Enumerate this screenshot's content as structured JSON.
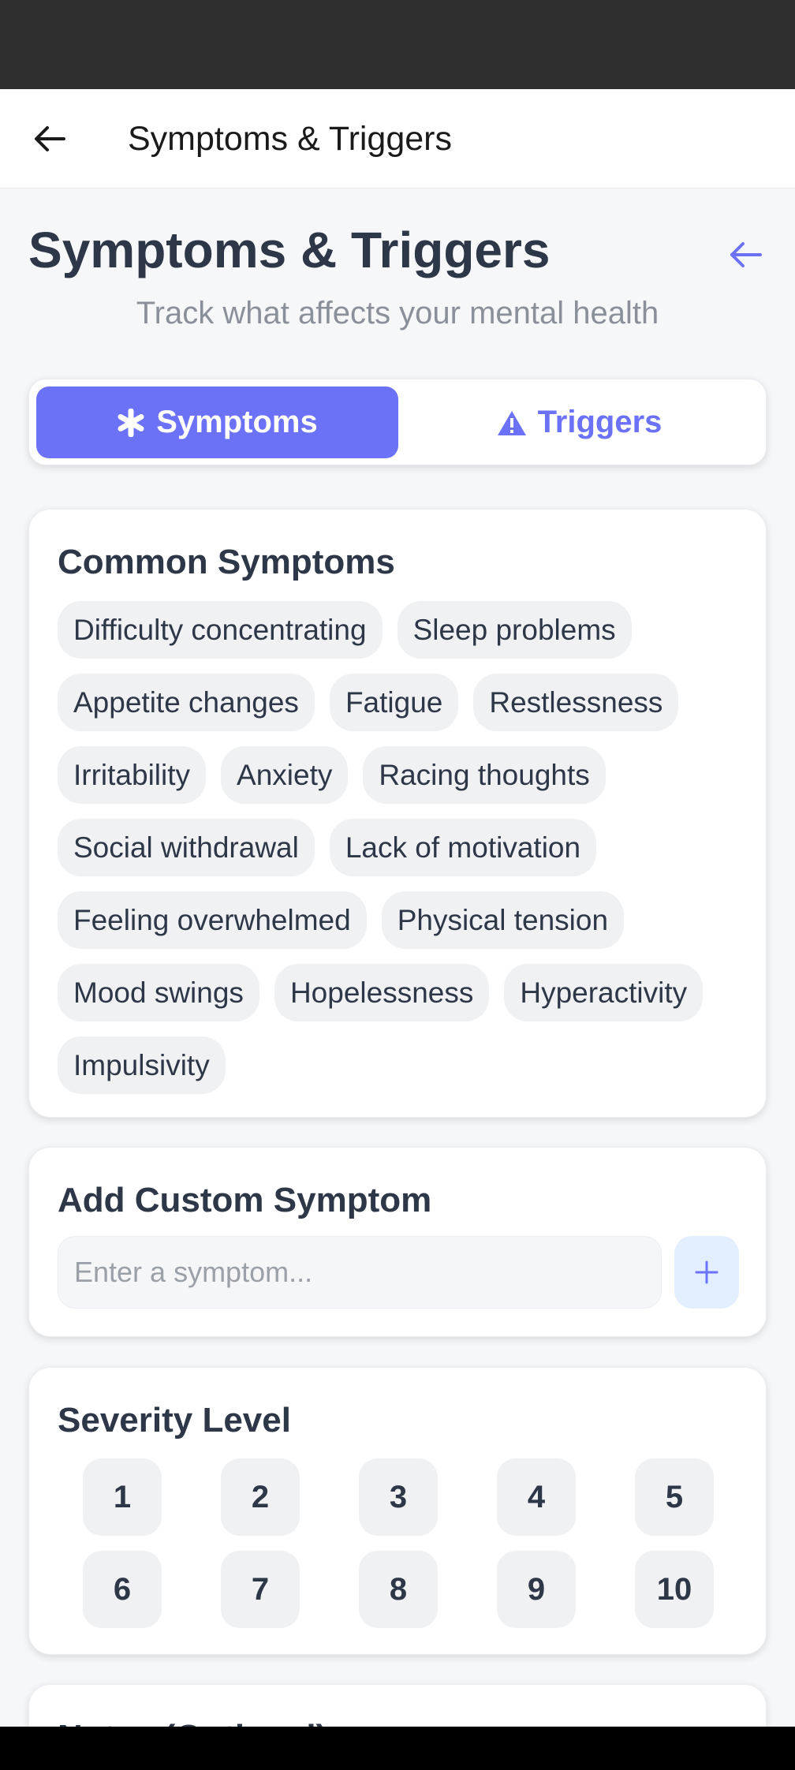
{
  "app_bar": {
    "title": "Symptoms & Triggers"
  },
  "header": {
    "title": "Symptoms & Triggers",
    "subtitle": "Track what affects your mental health"
  },
  "tabs": [
    {
      "label": "Symptoms",
      "icon": "asterisk-icon",
      "active": true
    },
    {
      "label": "Triggers",
      "icon": "warning-icon",
      "active": false
    }
  ],
  "common_symptoms": {
    "title": "Common Symptoms",
    "items": [
      "Difficulty concentrating",
      "Sleep problems",
      "Appetite changes",
      "Fatigue",
      "Restlessness",
      "Irritability",
      "Anxiety",
      "Racing thoughts",
      "Social withdrawal",
      "Lack of motivation",
      "Feeling overwhelmed",
      "Physical tension",
      "Mood swings",
      "Hopelessness",
      "Hyperactivity",
      "Impulsivity"
    ]
  },
  "custom_symptom": {
    "title": "Add Custom Symptom",
    "placeholder": "Enter a symptom...",
    "add_icon": "plus-icon"
  },
  "severity": {
    "title": "Severity Level",
    "levels": [
      "1",
      "2",
      "3",
      "4",
      "5",
      "6",
      "7",
      "8",
      "9",
      "10"
    ]
  },
  "notes": {
    "title": "Notes (Optional)"
  },
  "colors": {
    "accent": "#6b72f7",
    "text": "#2d3748",
    "chip_bg": "#f0f1f3"
  }
}
